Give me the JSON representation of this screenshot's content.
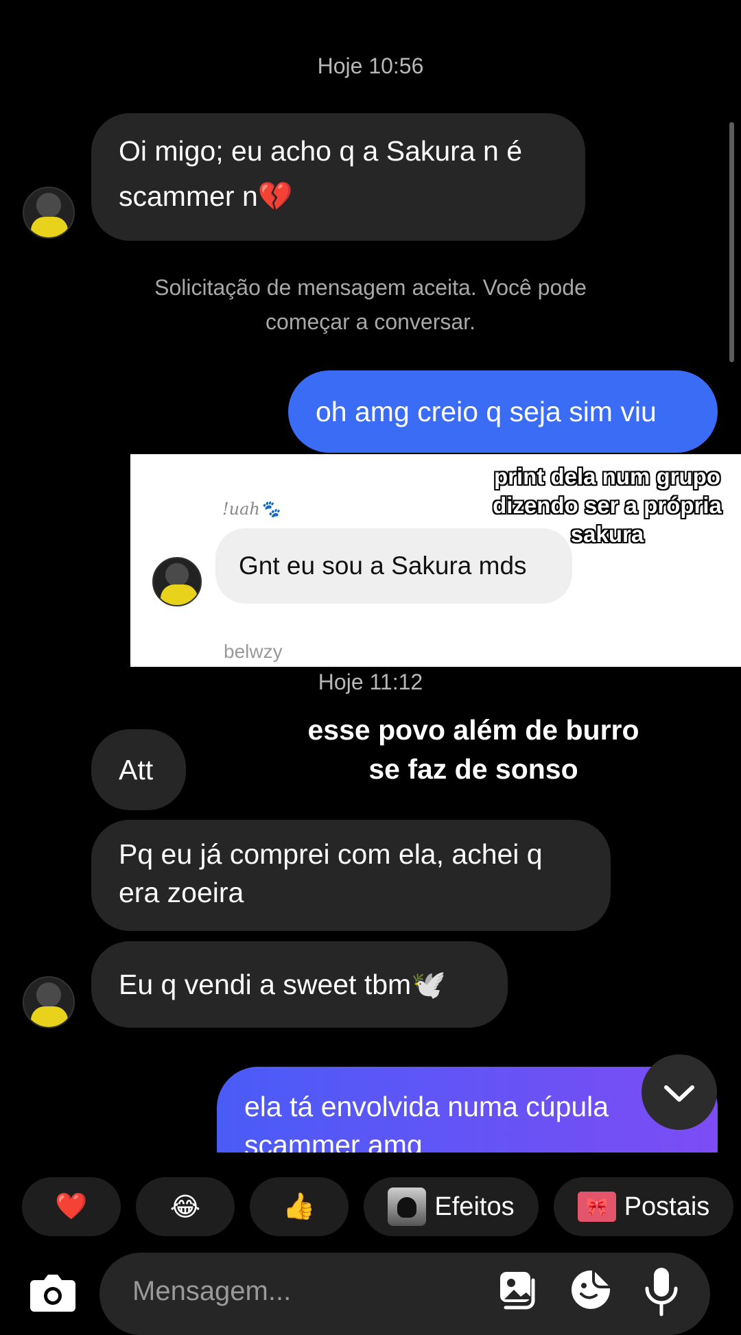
{
  "chat": {
    "timestamp_1": "Hoje 10:56",
    "msg_1": "Oi migo; eu acho q a Sakura n é scammer n💔",
    "system_notice": "Solicitação de mensagem aceita. Você pode começar a conversar.",
    "msg_out_1": "oh amg creio q seja sim viu",
    "timestamp_2": "Hoje 11:12",
    "msg_2": "Att",
    "msg_3": "Pq eu já comprei com ela, achei q era zoeira",
    "msg_4": "Eu q vendi a sweet tbm🕊️",
    "msg_out_2": "ela tá envolvida numa cúpula scammer amg"
  },
  "overlay_screenshot": {
    "sender_name": "!uah🐾",
    "message": "Gnt eu sou a Sakura mds",
    "footer_name": "belwzy"
  },
  "captions": {
    "caption_1": "print dela num grupo dizendo ser a própria sakura",
    "caption_2": "esse povo além de burro se faz de sonso"
  },
  "quick_reactions": {
    "heart": "❤️",
    "laugh": "😂",
    "thumbs": "👍",
    "effects_label": "Efeitos",
    "postcards_label": "Postais",
    "postcards_icon": "🎀"
  },
  "composer": {
    "placeholder": "Mensagem..."
  }
}
